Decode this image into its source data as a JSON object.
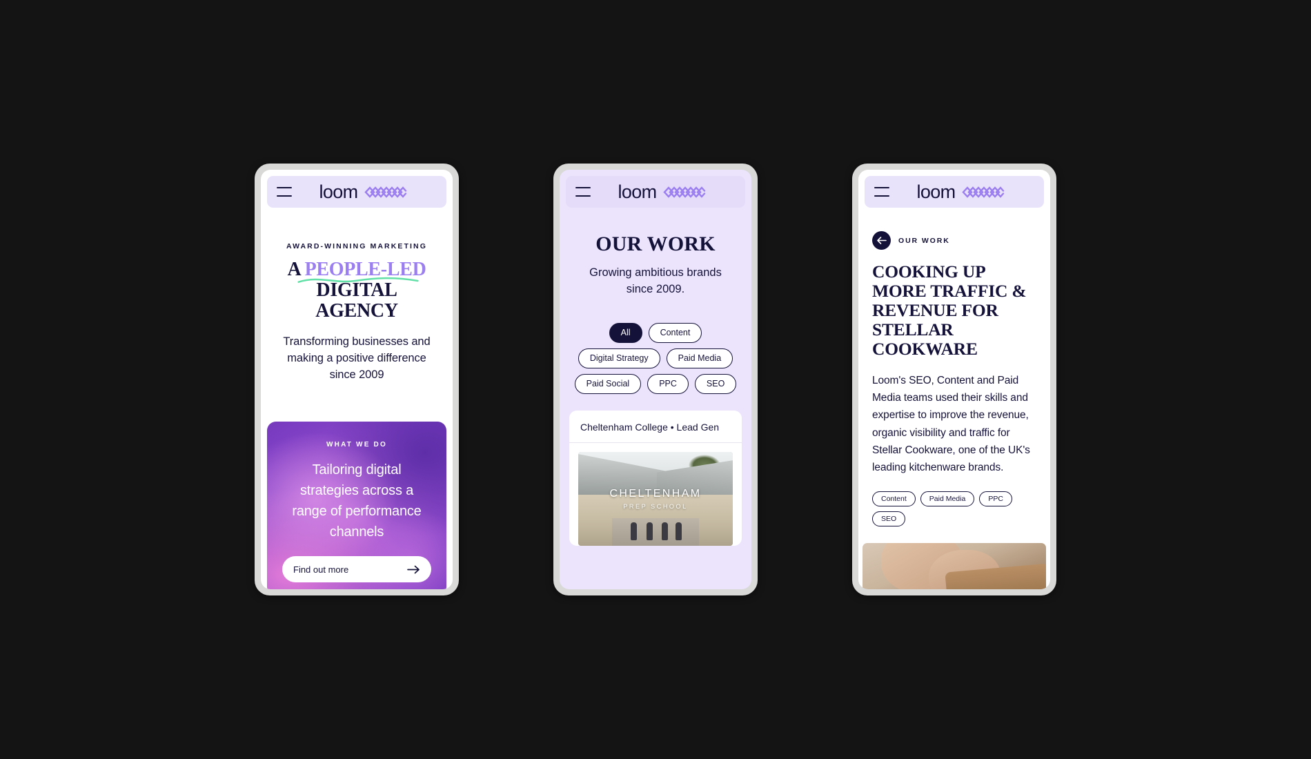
{
  "brand": {
    "word": "loom",
    "mark_color": "#9b7ef0",
    "text_color": "#15123a",
    "menu_icon": "hamburger-icon"
  },
  "theme": {
    "background": "#141414",
    "navy": "#15123a",
    "lavender_bar": "#e9e2fb",
    "lavender_page": "#ebe4fc",
    "accent_purple": "#9b7ef0",
    "squiggle_green": "#63e0a8"
  },
  "phone1": {
    "eyebrow": "AWARD-WINNING MARKETING",
    "title_line1_plain": "A ",
    "title_line1_accent": "PEOPLE-LED",
    "title_line2": "DIGITAL AGENCY",
    "subtitle": "Transforming businesses and making a positive difference since 2009",
    "promo": {
      "eyebrow": "WHAT WE DO",
      "heading": "Tailoring digital strategies across a range of performance channels",
      "cta_label": "Find out more",
      "cta_icon": "arrow-right-icon"
    }
  },
  "phone2": {
    "title": "OUR WORK",
    "subtitle": "Growing ambitious brands since 2009.",
    "filters": [
      {
        "label": "All",
        "active": true
      },
      {
        "label": "Content",
        "active": false
      },
      {
        "label": "Digital Strategy",
        "active": false
      },
      {
        "label": "Paid Media",
        "active": false
      },
      {
        "label": "Paid Social",
        "active": false
      },
      {
        "label": "PPC",
        "active": false
      },
      {
        "label": "SEO",
        "active": false
      }
    ],
    "card": {
      "title": "Cheltenham College • Lead Gen",
      "photo_caption": "CHELTENHAM",
      "photo_caption_sub": "PREP SCHOOL"
    }
  },
  "phone3": {
    "breadcrumb": "OUR WORK",
    "back_icon": "arrow-left-icon",
    "title": "COOKING UP MORE TRAFFIC & REVENUE FOR STELLAR COOKWARE",
    "body": "Loom's SEO, Content and Paid Media teams used their skills and expertise to improve the revenue, organic visibility and traffic for Stellar Cookware, one of the UK's leading kitchenware brands.",
    "tags": [
      "Content",
      "Paid Media",
      "PPC",
      "SEO"
    ]
  }
}
